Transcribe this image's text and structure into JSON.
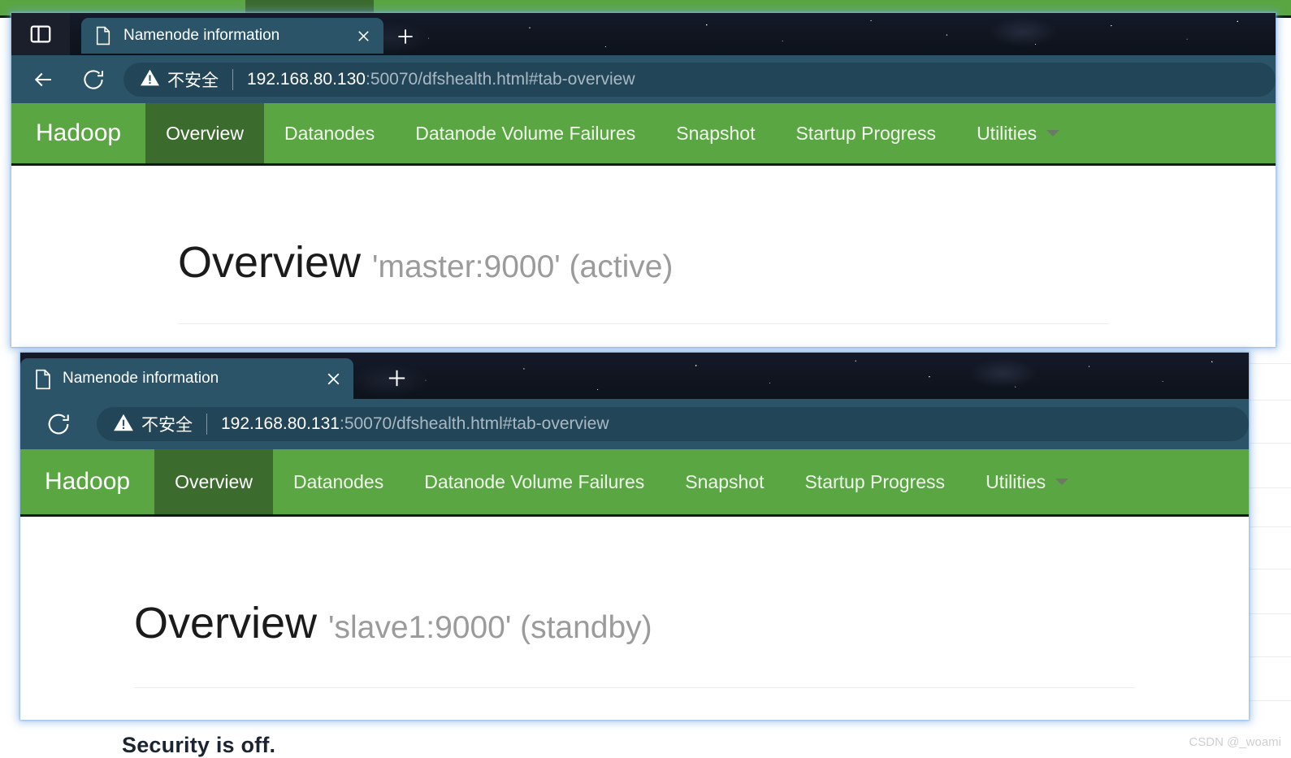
{
  "background": {
    "occluded_page_text": "Security is off.",
    "nav_bar_color": "#5aa642",
    "nav_active_color": "#3c6b2e"
  },
  "watermark": {
    "text": "CSDN @_woami"
  },
  "windows": [
    {
      "id": "win1",
      "browser": {
        "system_button_icon": "tab-list-icon",
        "tab": {
          "favicon": "page-icon",
          "title": "Namenode information",
          "close_icon": "close-icon"
        },
        "new_tab_icon": "plus-icon",
        "back_icon": "back-arrow-icon",
        "reload_icon": "reload-icon",
        "security": {
          "warning_icon": "warning-triangle-icon",
          "label": "不安全"
        },
        "url_host": "192.168.80.130",
        "url_rest": ":50070/dfshealth.html#tab-overview"
      },
      "hadoop": {
        "brand": "Hadoop",
        "nav": [
          {
            "label": "Overview",
            "active": true
          },
          {
            "label": "Datanodes",
            "active": false
          },
          {
            "label": "Datanode Volume Failures",
            "active": false
          },
          {
            "label": "Snapshot",
            "active": false
          },
          {
            "label": "Startup Progress",
            "active": false
          },
          {
            "label": "Utilities",
            "active": false,
            "has_caret": true
          }
        ],
        "heading": "Overview",
        "subheading": "'master:9000' (active)"
      }
    },
    {
      "id": "win2",
      "browser": {
        "tab": {
          "favicon": "page-icon",
          "title": "Namenode information",
          "close_icon": "close-icon"
        },
        "new_tab_icon": "plus-icon",
        "reload_icon": "reload-icon",
        "security": {
          "warning_icon": "warning-triangle-icon",
          "label": "不安全"
        },
        "url_host": "192.168.80.131",
        "url_rest": ":50070/dfshealth.html#tab-overview"
      },
      "hadoop": {
        "brand": "Hadoop",
        "nav": [
          {
            "label": "Overview",
            "active": true
          },
          {
            "label": "Datanodes",
            "active": false
          },
          {
            "label": "Datanode Volume Failures",
            "active": false
          },
          {
            "label": "Snapshot",
            "active": false
          },
          {
            "label": "Startup Progress",
            "active": false
          },
          {
            "label": "Utilities",
            "active": false,
            "has_caret": true
          }
        ],
        "heading": "Overview",
        "subheading": "'slave1:9000' (standby)"
      }
    }
  ]
}
